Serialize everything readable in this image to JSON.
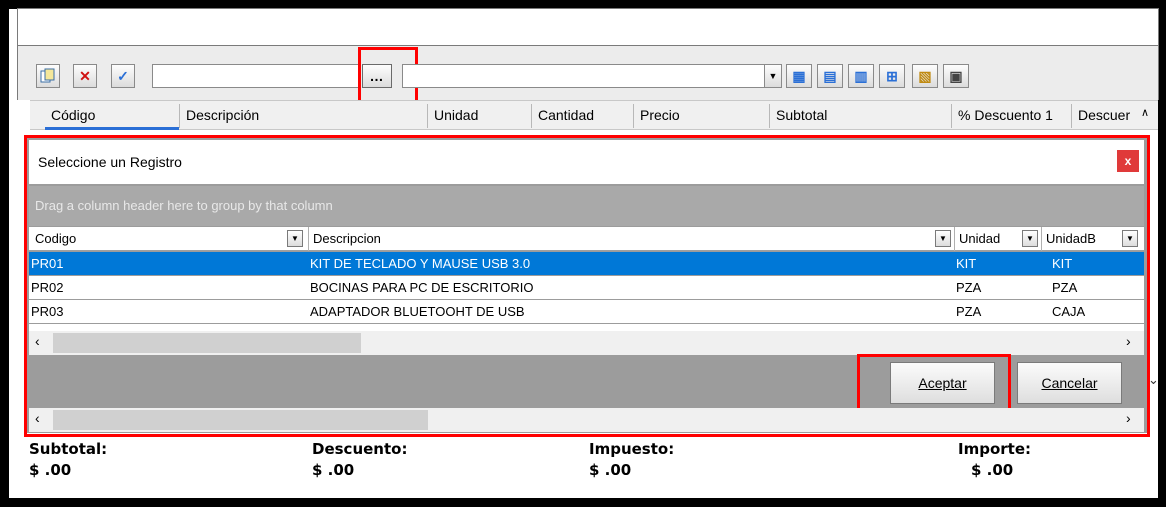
{
  "toolbar": {
    "browse_button_label": "…"
  },
  "columns": [
    "Código",
    "Descripción",
    "Unidad",
    "Cantidad",
    "Precio",
    "Subtotal",
    "% Descuento 1",
    "Descuer"
  ],
  "dialog": {
    "title": "Seleccione un Registro",
    "close_glyph": "x",
    "group_panel_text": "Drag a column header here to group by that column",
    "headers": [
      "Codigo",
      "Descripcion",
      "Unidad",
      "UnidadB"
    ],
    "rows": [
      [
        "PR01",
        "KIT DE TECLADO Y MAUSE USB 3.0",
        "KIT",
        "KIT"
      ],
      [
        "PR02",
        "BOCINAS PARA PC DE ESCRITORIO",
        "PZA",
        "PZA"
      ],
      [
        "PR03",
        "ADAPTADOR BLUETOOHT DE USB",
        "PZA",
        "CAJA"
      ]
    ],
    "accept_label": "Aceptar",
    "cancel_label": "Cancelar"
  },
  "totals": {
    "subtotal_label": "Subtotal:",
    "subtotal_value": "$ .00",
    "discount_label": "Descuento:",
    "discount_value": "$ .00",
    "tax_label": "Impuesto:",
    "tax_value": "$ .00",
    "amount_label": "Importe:",
    "amount_value": "$ .00"
  },
  "colors": {
    "selection": "#0078d7",
    "highlight": "#ff0000",
    "close_button": "#e03a3a"
  }
}
